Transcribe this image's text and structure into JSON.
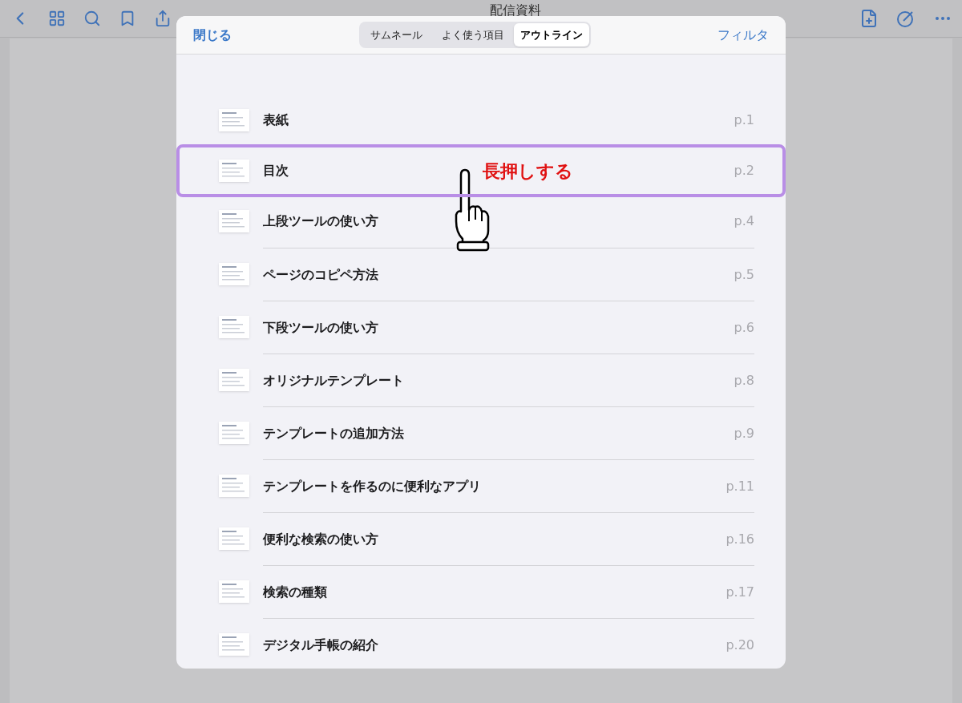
{
  "document_title": "配信資料",
  "dialog": {
    "close": "閉じる",
    "filter": "フィルタ",
    "tabs": [
      {
        "label": "サムネール",
        "selected": false
      },
      {
        "label": "よく使う項目",
        "selected": false
      },
      {
        "label": "アウトライン",
        "selected": true
      }
    ],
    "outline": [
      {
        "title": "表紙",
        "page": "p.1",
        "highlighted": false
      },
      {
        "title": "目次",
        "page": "p.2",
        "highlighted": true
      },
      {
        "title": "上段ツールの使い方",
        "page": "p.4",
        "highlighted": false
      },
      {
        "title": "ページのコピペ方法",
        "page": "p.5",
        "highlighted": false
      },
      {
        "title": "下段ツールの使い方",
        "page": "p.6",
        "highlighted": false
      },
      {
        "title": "オリジナルテンプレート",
        "page": "p.8",
        "highlighted": false
      },
      {
        "title": "テンプレートの追加方法",
        "page": "p.9",
        "highlighted": false
      },
      {
        "title": "テンプレートを作るのに便利なアプリ",
        "page": "p.11",
        "highlighted": false
      },
      {
        "title": "便利な検索の使い方",
        "page": "p.16",
        "highlighted": false
      },
      {
        "title": "検索の種類",
        "page": "p.17",
        "highlighted": false
      },
      {
        "title": "デジタル手帳の紹介",
        "page": "p.20",
        "highlighted": false
      }
    ]
  },
  "annotation": {
    "text": "長押しする"
  }
}
